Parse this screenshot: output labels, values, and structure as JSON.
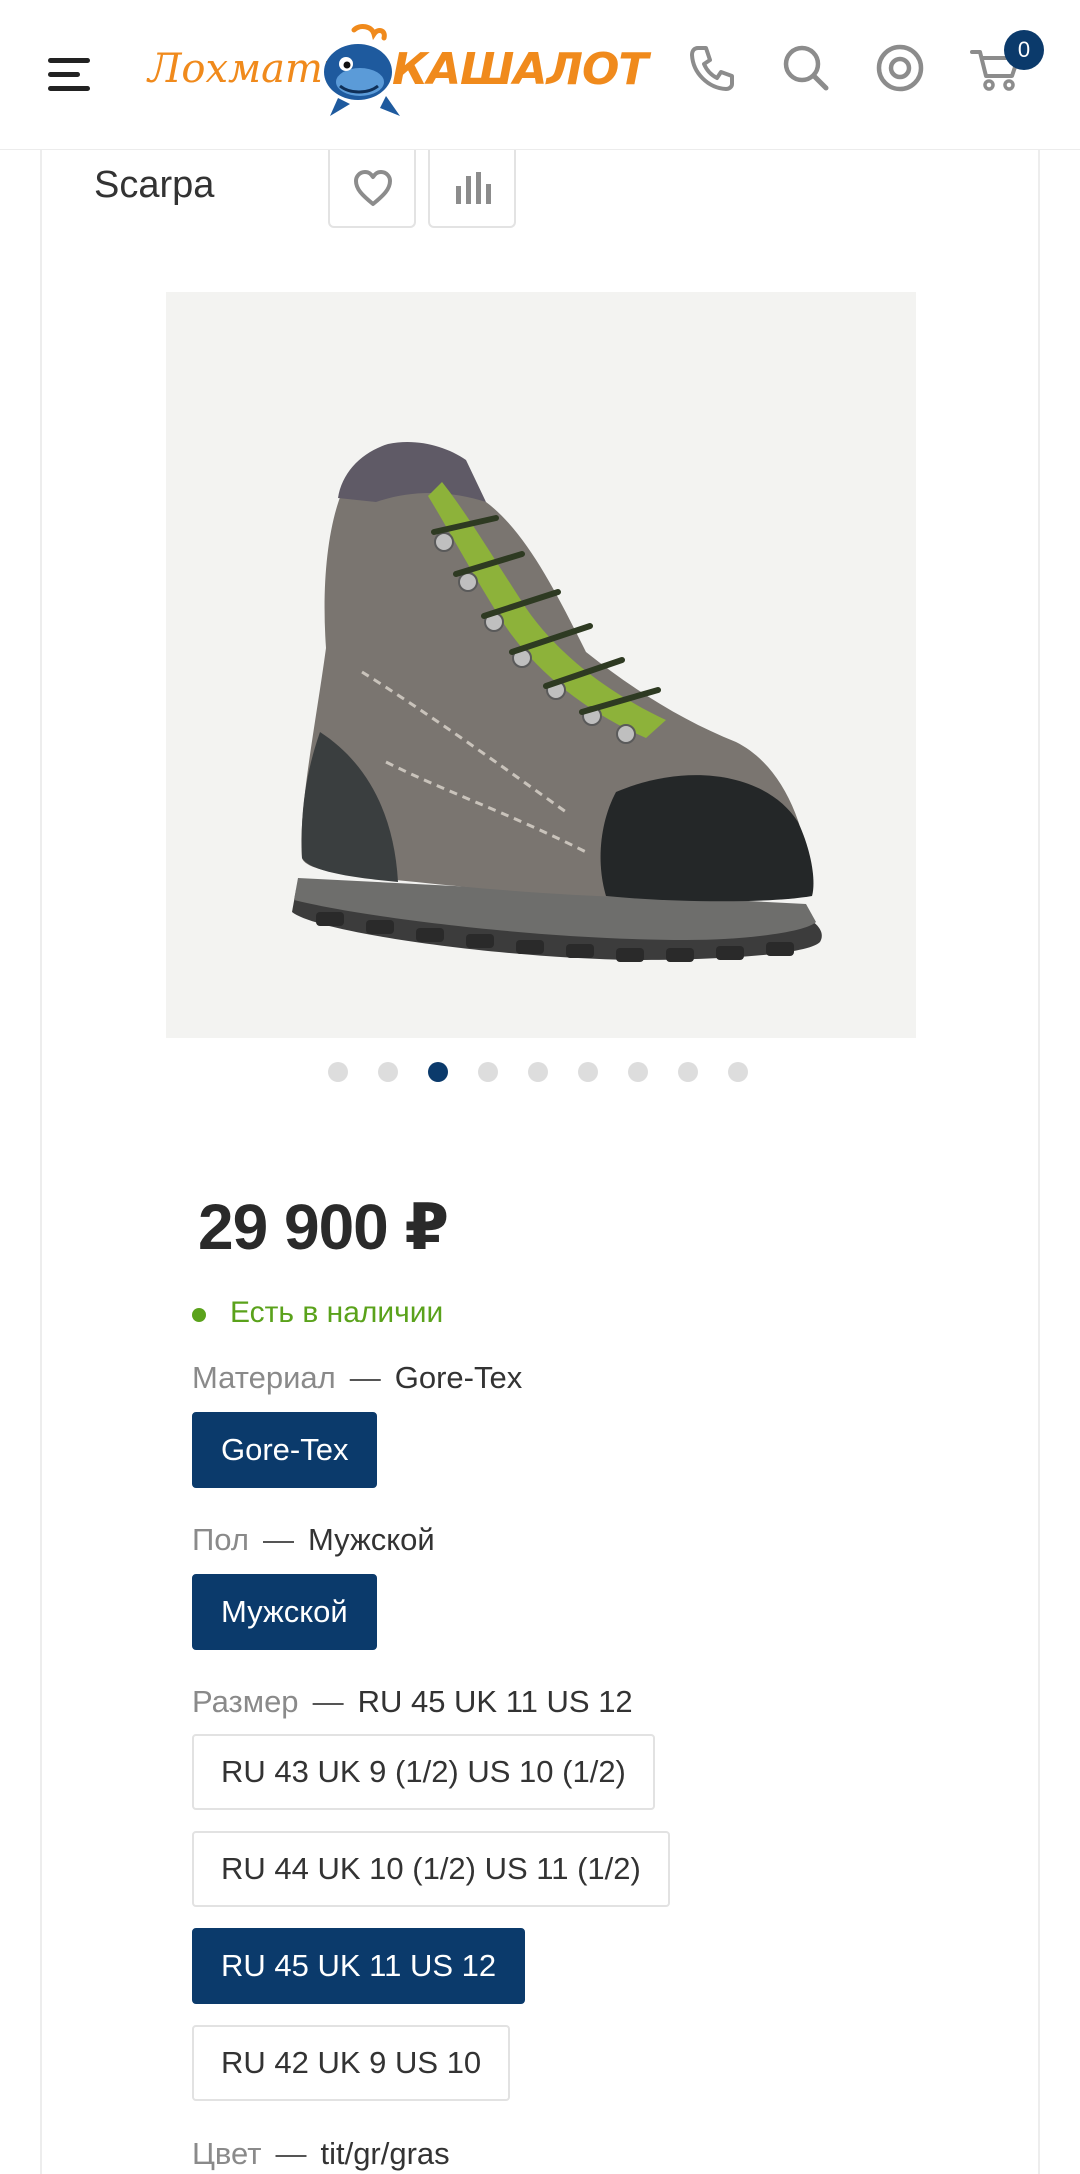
{
  "header": {
    "logo_word1": "Лохматый",
    "logo_word2": "КАШАЛОТ",
    "icons": [
      "menu-icon",
      "phone-icon",
      "search-icon",
      "account-icon",
      "cart-icon"
    ],
    "cart_count": "0"
  },
  "product": {
    "brand": "Scarpa",
    "price": "29 900 ₽",
    "stock": "Есть в наличии",
    "gallery": {
      "total": 9,
      "active_index": 2
    }
  },
  "material": {
    "label": "Материал",
    "value": "Gore-Tex",
    "options": [
      {
        "label": "Gore-Tex",
        "selected": true
      }
    ]
  },
  "gender": {
    "label": "Пол",
    "value": "Мужской",
    "options": [
      {
        "label": "Мужской",
        "selected": true
      }
    ]
  },
  "size": {
    "label": "Размер",
    "value": "RU 45 UK 11 US 12",
    "options": [
      {
        "label": "RU 43 UK 9 (1/2) US 10 (1/2)",
        "selected": false
      },
      {
        "label": "RU 44 UK 10 (1/2) US 11 (1/2)",
        "selected": false
      },
      {
        "label": "RU 45 UK 11 US 12",
        "selected": true
      },
      {
        "label": "RU 42 UK 9 US 10",
        "selected": false
      }
    ]
  },
  "color": {
    "label": "Цвет",
    "value": "tit/gr/gras"
  },
  "colors": {
    "accent": "#0b3a6b",
    "logo": "#f08a1c",
    "in_stock": "#5aa21b"
  },
  "separator": "—"
}
